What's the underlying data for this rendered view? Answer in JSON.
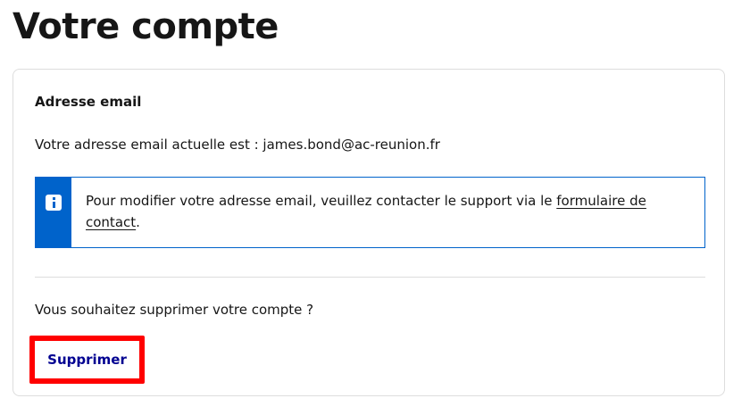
{
  "page": {
    "title": "Votre compte"
  },
  "email_section": {
    "heading": "Adresse email",
    "current_text": "Votre adresse email actuelle est : james.bond@ac-reunion.fr"
  },
  "notice": {
    "icon": "info-icon",
    "text_before": "Pour modifier votre adresse email, veuillez contacter le support via le ",
    "link_label": "formulaire de contact",
    "text_after": ".",
    "accent_color": "#0063cb"
  },
  "delete_section": {
    "question": "Vous souhaitez supprimer votre compte ?",
    "button_label": "Supprimer",
    "button_color": "#000091",
    "highlight_color": "#ff0000"
  }
}
